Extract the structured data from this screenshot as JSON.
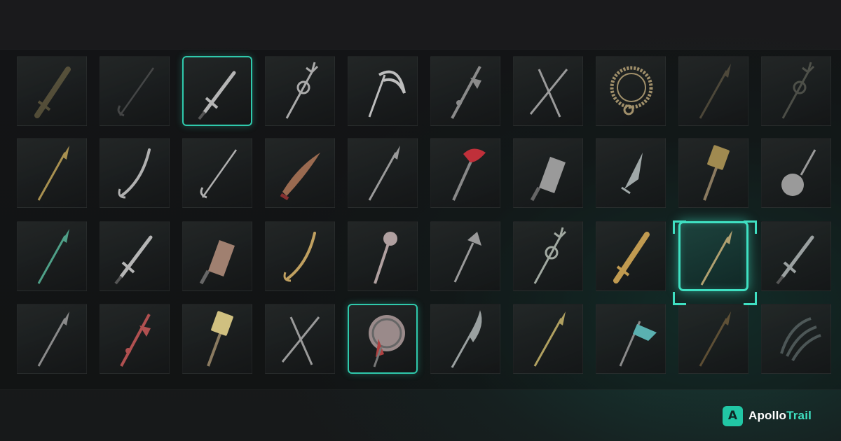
{
  "brand": {
    "mark": "A",
    "name_part1": "Apollo",
    "name_part2": "Trail",
    "accent_color": "#3fe0c2"
  },
  "inventory": {
    "rows": 4,
    "columns": 10,
    "items": [
      {
        "icon": "greatsword-icon",
        "state": "dim",
        "tint": "#9a8a5a"
      },
      {
        "icon": "rapier-icon",
        "state": "dim",
        "tint": "#777777"
      },
      {
        "icon": "sword-icon",
        "state": "selected",
        "tint": "#b5b5b5"
      },
      {
        "icon": "trident-icon",
        "state": "normal",
        "tint": "#aaaaaa"
      },
      {
        "icon": "scythe-icon",
        "state": "normal",
        "tint": "#bdbdbd"
      },
      {
        "icon": "halberd-icon",
        "state": "normal",
        "tint": "#8a8a8a"
      },
      {
        "icon": "crossed-swords-icon",
        "state": "normal",
        "tint": "#9a9a9a"
      },
      {
        "icon": "chakram-icon",
        "state": "normal",
        "tint": "#a08f6a"
      },
      {
        "icon": "spear-icon",
        "state": "dim",
        "tint": "#8a7a5a"
      },
      {
        "icon": "trident-icon",
        "state": "dim",
        "tint": "#8a8a7a"
      },
      {
        "icon": "spear-icon",
        "state": "normal",
        "tint": "#a89050"
      },
      {
        "icon": "sabre-icon",
        "state": "normal",
        "tint": "#b0b0b0"
      },
      {
        "icon": "rapier-icon",
        "state": "normal",
        "tint": "#b0b0b0"
      },
      {
        "icon": "kukri-icon",
        "state": "normal",
        "tint": "#9a6a50"
      },
      {
        "icon": "spear-icon",
        "state": "normal",
        "tint": "#9a9a9a"
      },
      {
        "icon": "axe-icon",
        "state": "normal",
        "tint": "#c0303a"
      },
      {
        "icon": "cleaver-icon",
        "state": "normal",
        "tint": "#9a9a9a"
      },
      {
        "icon": "dagger-icon",
        "state": "normal",
        "tint": "#a0a8a8"
      },
      {
        "icon": "hammer-icon",
        "state": "normal",
        "tint": "#a08a50"
      },
      {
        "icon": "flail-icon",
        "state": "normal",
        "tint": "#9a9a9a"
      },
      {
        "icon": "spear-icon",
        "state": "normal",
        "tint": "#4fa088"
      },
      {
        "icon": "sword-icon",
        "state": "normal",
        "tint": "#b5b5b5"
      },
      {
        "icon": "cleaver-icon",
        "state": "normal",
        "tint": "#a08070"
      },
      {
        "icon": "sabre-icon",
        "state": "normal",
        "tint": "#c0a060"
      },
      {
        "icon": "mace-icon",
        "state": "normal",
        "tint": "#b0a0a0"
      },
      {
        "icon": "shovel-icon",
        "state": "normal",
        "tint": "#9a9a9a"
      },
      {
        "icon": "trident-icon",
        "state": "normal",
        "tint": "#a0a8a0"
      },
      {
        "icon": "greatsword-icon",
        "state": "normal",
        "tint": "#c09a50"
      },
      {
        "icon": "spear-icon",
        "state": "focused",
        "tint": "#b0a070"
      },
      {
        "icon": "sword-icon",
        "state": "normal",
        "tint": "#9aa0a0"
      },
      {
        "icon": "spear-icon",
        "state": "normal",
        "tint": "#8a8a8a"
      },
      {
        "icon": "halberd-icon",
        "state": "normal",
        "tint": "#b05050"
      },
      {
        "icon": "hammer-icon",
        "state": "normal",
        "tint": "#d0c080"
      },
      {
        "icon": "crossed-swords-icon",
        "state": "normal",
        "tint": "#9a9a9a"
      },
      {
        "icon": "shield-mace-icon",
        "state": "selected",
        "tint": "#b04040"
      },
      {
        "icon": "glaive-icon",
        "state": "normal",
        "tint": "#9aa0a0"
      },
      {
        "icon": "spear-icon",
        "state": "normal",
        "tint": "#b0a060"
      },
      {
        "icon": "banner-spear-icon",
        "state": "normal",
        "tint": "#5ab0b0"
      },
      {
        "icon": "spear-icon",
        "state": "dim",
        "tint": "#b08a50"
      },
      {
        "icon": "claw-icon",
        "state": "dim",
        "tint": "#8a9a9a"
      }
    ]
  }
}
